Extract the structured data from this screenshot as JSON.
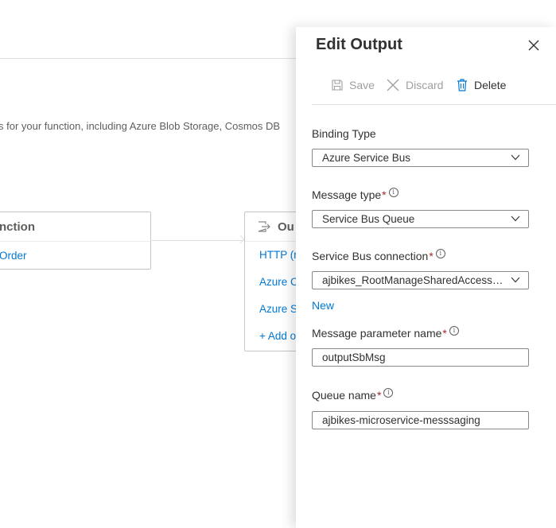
{
  "background": {
    "description": "s for your function, including Azure Blob Storage, Cosmos DB",
    "function_card": {
      "title": "nction",
      "link": "Order"
    },
    "outputs_card": {
      "title": "Ou",
      "items": [
        "HTTP (r",
        "Azure C",
        "Azure S",
        "+ Add o"
      ]
    }
  },
  "panel": {
    "title": "Edit Output",
    "toolbar": {
      "save_label": "Save",
      "discard_label": "Discard",
      "delete_label": "Delete"
    },
    "fields": {
      "binding_type": {
        "label": "Binding Type",
        "value": "Azure Service Bus"
      },
      "message_type": {
        "label": "Message type",
        "required_marker": "*",
        "value": "Service Bus Queue"
      },
      "service_bus_connection": {
        "label": "Service Bus connection",
        "required_marker": "*",
        "value": "ajbikes_RootManageSharedAccessKey",
        "new_link": "New"
      },
      "message_parameter_name": {
        "label": "Message parameter name",
        "required_marker": "*",
        "value": "outputSbMsg"
      },
      "queue_name": {
        "label": "Queue name",
        "required_marker": "*",
        "value": "ajbikes-microservice-messsaging"
      }
    },
    "info_glyph": "i"
  },
  "colors": {
    "accent": "#0078d4",
    "required": "#a4262c",
    "disabled_text": "#a19f9d",
    "border": "#8a8886"
  },
  "icons": [
    "save-icon",
    "discard-icon",
    "delete-icon",
    "close-icon",
    "chevron-down-icon",
    "info-icon",
    "output-icon"
  ]
}
